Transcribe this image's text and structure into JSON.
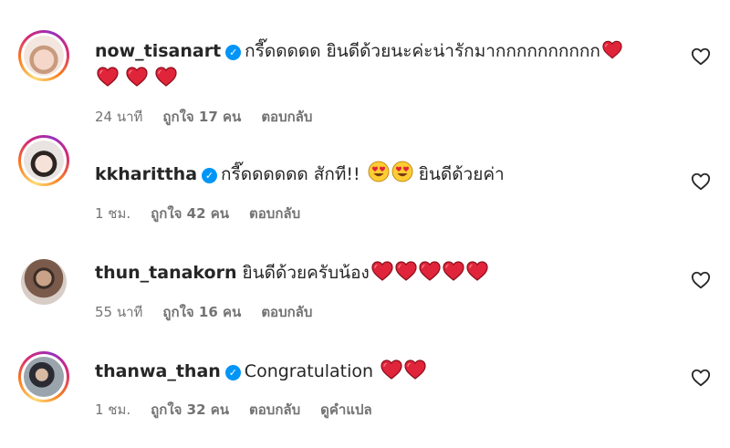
{
  "comments": [
    {
      "username": "now_tisanart",
      "verified": true,
      "text": "กรี๊ดดดดด ยินดีด้วยนะค่ะน่ารักมากกกกกกกกกก",
      "hearts_inline": 1,
      "hearts_line2": 3,
      "time": "24 นาที",
      "likes": "ถูกใจ 17 คน",
      "reply": "ตอบกลับ"
    },
    {
      "username": "kkharittha",
      "verified": true,
      "text": "กรี๊ดดดดดด สักที!!",
      "text_after": "ยินดีด้วยค่า",
      "time": "1 ชม.",
      "likes": "ถูกใจ 42 คน",
      "reply": "ตอบกลับ"
    },
    {
      "username": "thun_tanakorn",
      "verified": false,
      "text": "ยินดีด้วยครับน้อง",
      "hearts_inline": 5,
      "time": "55 นาที",
      "likes": "ถูกใจ 16 คน",
      "reply": "ตอบกลับ"
    },
    {
      "username": "thanwa_than",
      "verified": true,
      "text": "Congratulation",
      "hearts_inline": 2,
      "time": "1 ชม.",
      "likes": "ถูกใจ 32 คน",
      "reply": "ตอบกลับ",
      "translate": "ดูคำแปล"
    }
  ],
  "colors": {
    "verified": "#0095f6",
    "heart": "#e0243a",
    "meta": "#737373"
  },
  "icons": {
    "verified": "verified-badge-icon",
    "like": "heart-outline-icon",
    "heart_emoji": "red-heart-emoji",
    "star_eyes_emoji": "heart-eyes-emoji"
  }
}
